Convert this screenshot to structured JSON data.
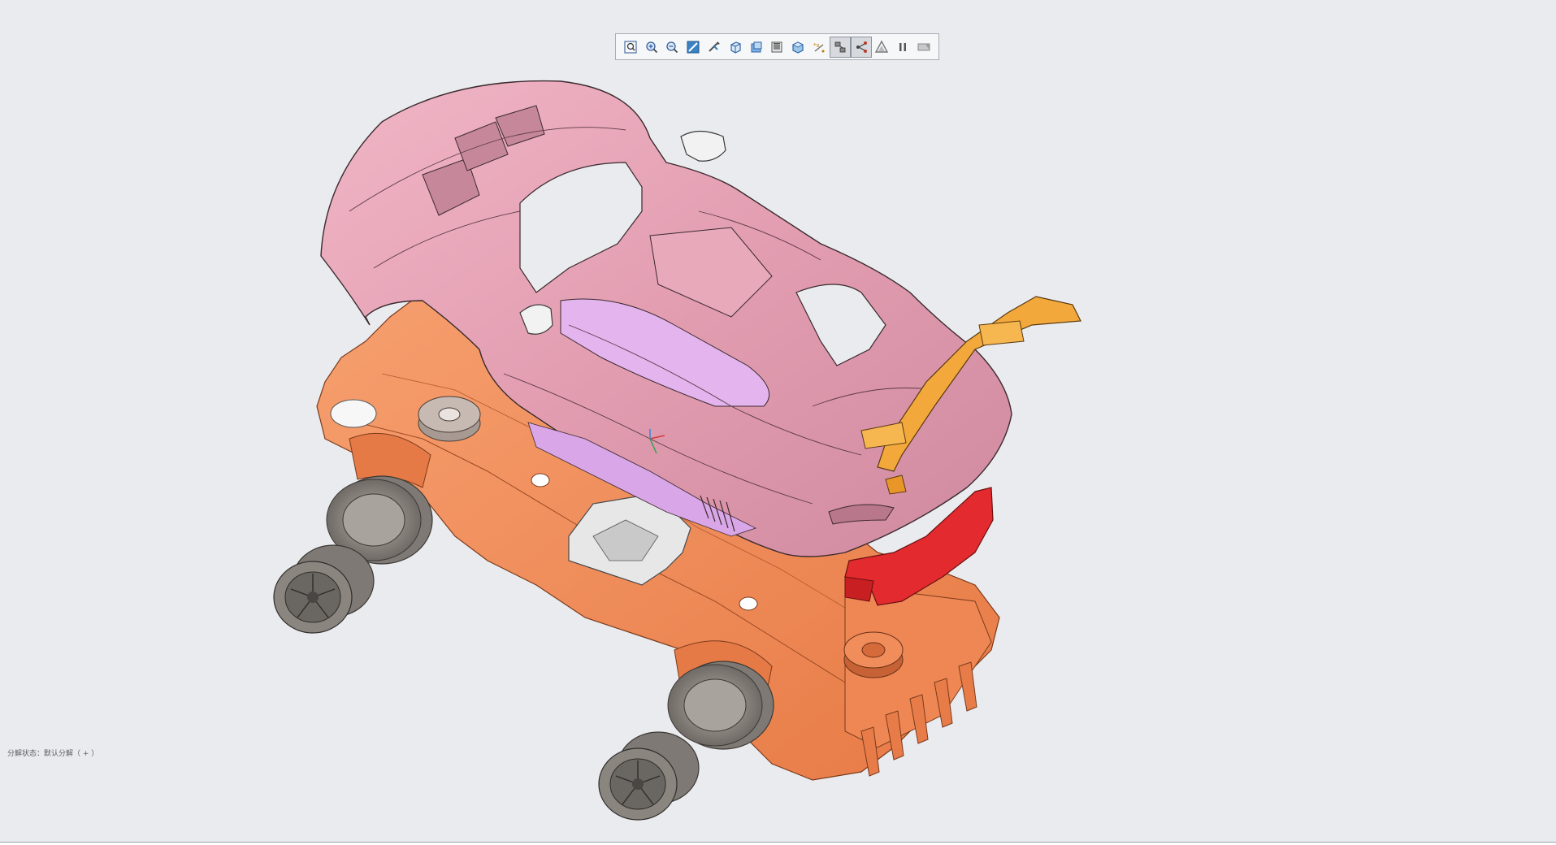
{
  "viewport": {
    "background": "#e9ebee",
    "status_text": "分解状态：默认分解（ + ）"
  },
  "toolbar": {
    "buttons": [
      {
        "icon": "zoom-fit-icon",
        "active": false
      },
      {
        "icon": "zoom-in-icon",
        "active": false
      },
      {
        "icon": "zoom-out-icon",
        "active": false
      },
      {
        "icon": "repaint-icon",
        "active": false
      },
      {
        "icon": "reorient-icon",
        "active": false
      },
      {
        "icon": "saved-views-icon",
        "active": false
      },
      {
        "icon": "display-style-icon",
        "active": false
      },
      {
        "icon": "view-manager-icon",
        "active": false
      },
      {
        "icon": "perspective-view-icon",
        "active": false
      },
      {
        "icon": "datum-display-icon",
        "active": false
      },
      {
        "icon": "explode-view-icon",
        "active": true
      },
      {
        "icon": "offset-lines-icon",
        "active": true
      },
      {
        "icon": "annotation-display-icon",
        "active": false
      },
      {
        "icon": "pause-icon",
        "active": false
      },
      {
        "icon": "spin-center-icon",
        "active": false
      }
    ]
  },
  "colors": {
    "body_pink": "#e6a3b6",
    "body_pink_dark": "#c98397",
    "glass_lilac": "#e3b4ee",
    "chassis_orange": "#f08a58",
    "chassis_orange_dark": "#d86c3d",
    "wing_yellow": "#f3a83c",
    "diffuser_red": "#e32a2e",
    "tire_gray": "#8a8580",
    "rim_gray": "#6d6a67",
    "mirror_white": "#f2f2f2"
  }
}
